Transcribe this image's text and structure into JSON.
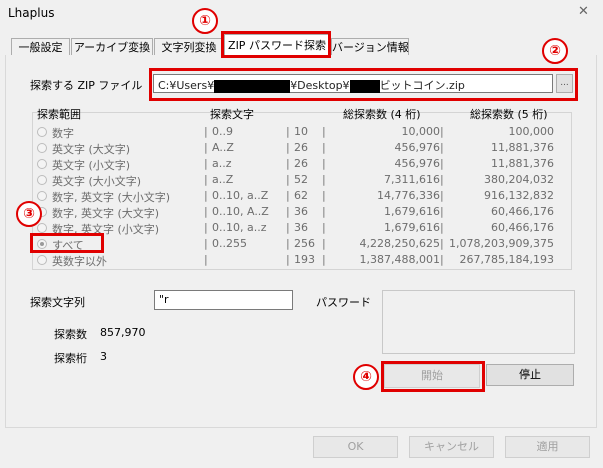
{
  "window": {
    "title": "Lhaplus",
    "close_glyph": "✕"
  },
  "tabs": [
    {
      "label": "一般設定"
    },
    {
      "label": "アーカイブ変換"
    },
    {
      "label": "文字列変換"
    },
    {
      "label": "ZIP パスワード探索",
      "selected": true
    },
    {
      "label": "バージョン情報"
    }
  ],
  "zip_file": {
    "label": "探索する ZIP ファイル",
    "path_prefix": "C:¥Users¥",
    "path_mid": "¥Desktop¥",
    "path_suffix": "ビットコイン.zip",
    "browse_label": "..."
  },
  "range_table": {
    "headers": [
      "探索範囲",
      "探索文字",
      "総探索数 (4 桁)",
      "総探索数 (5 桁)"
    ],
    "rows": [
      {
        "label": "数字",
        "chars": "0..9",
        "count": "10",
        "total4": "10,000",
        "total5": "100,000",
        "selected": false
      },
      {
        "label": "英文字 (大文字)",
        "chars": "A..Z",
        "count": "26",
        "total4": "456,976",
        "total5": "11,881,376",
        "selected": false
      },
      {
        "label": "英文字 (小文字)",
        "chars": "a..z",
        "count": "26",
        "total4": "456,976",
        "total5": "11,881,376",
        "selected": false
      },
      {
        "label": "英文字 (大小文字)",
        "chars": "a..Z",
        "count": "52",
        "total4": "7,311,616",
        "total5": "380,204,032",
        "selected": false
      },
      {
        "label": "数字, 英文字 (大小文字)",
        "chars": "0..10, a..Z",
        "count": "62",
        "total4": "14,776,336",
        "total5": "916,132,832",
        "selected": false
      },
      {
        "label": "数字, 英文字 (大文字)",
        "chars": "0..10, A..Z",
        "count": "36",
        "total4": "1,679,616",
        "total5": "60,466,176",
        "selected": false
      },
      {
        "label": "数字, 英文字 (小文字)",
        "chars": "0..10, a..z",
        "count": "36",
        "total4": "1,679,616",
        "total5": "60,466,176",
        "selected": false
      },
      {
        "label": "すべて",
        "chars": "0..255",
        "count": "256",
        "total4": "4,228,250,625",
        "total5": "1,078,203,909,375",
        "selected": true
      },
      {
        "label": "英数字以外",
        "chars": "",
        "count": "193",
        "total4": "1,387,488,001",
        "total5": "267,785,184,193",
        "selected": false
      }
    ]
  },
  "search_string": {
    "label": "探索文字列",
    "value": "\"r"
  },
  "password": {
    "label": "パスワード",
    "value": ""
  },
  "stats": {
    "count_label": "探索数",
    "count_value": "857,970",
    "digits_label": "探索桁",
    "digits_value": "3"
  },
  "buttons": {
    "start": "開始",
    "stop": "停止",
    "ok": "OK",
    "cancel": "キャンセル",
    "apply": "適用"
  },
  "annotations": [
    "①",
    "②",
    "③",
    "④"
  ],
  "colors": {
    "annotation": "#e00000",
    "disabled_text": "#a0a0a0"
  }
}
